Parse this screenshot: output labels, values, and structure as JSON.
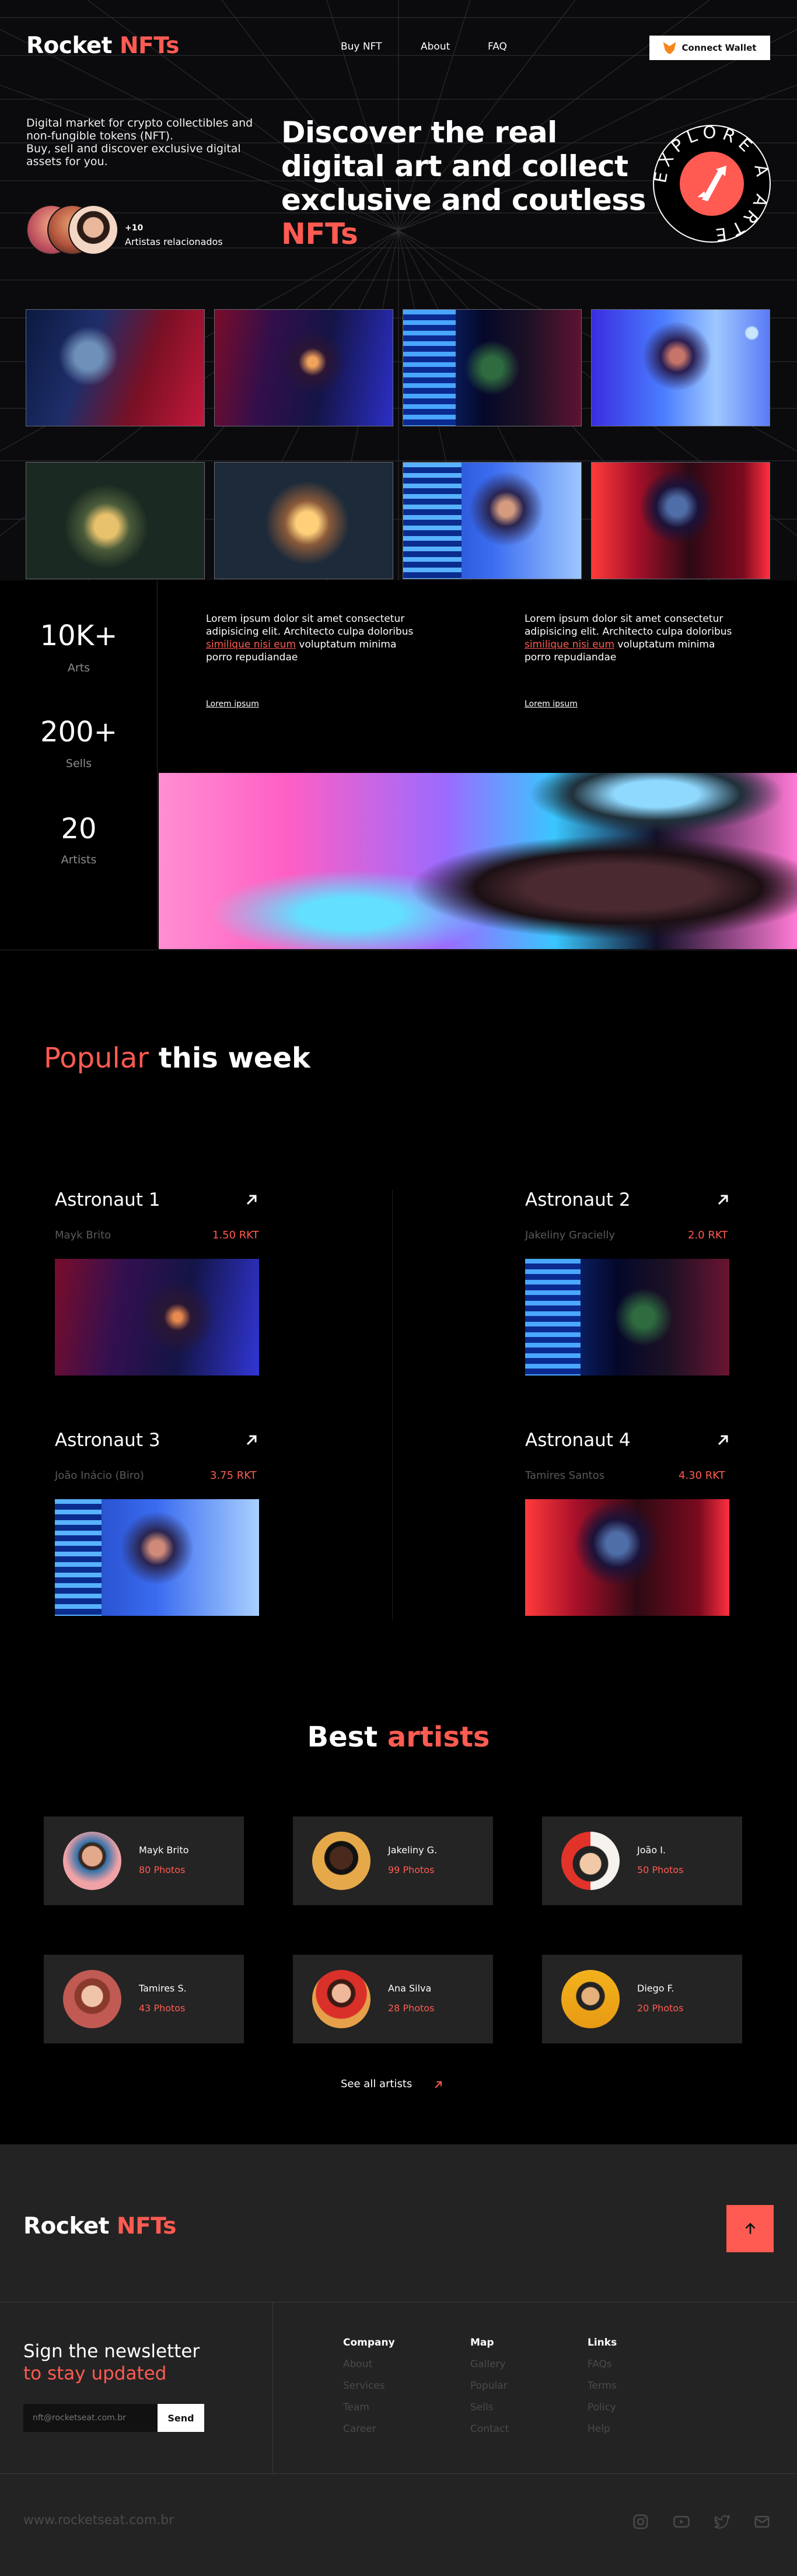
{
  "brand": {
    "part1": "Rocket",
    "part2": "NFTs"
  },
  "nav": {
    "items": [
      "Buy NFT",
      "About",
      "FAQ"
    ],
    "wallet_label": "Connect Wallet"
  },
  "hero": {
    "intro_line1": "Digital market for crypto collectibles and",
    "intro_line2": "non-fungible tokens (NFT).",
    "intro_line3": "Buy, sell and discover exclusive digital",
    "intro_line4": "assets for you.",
    "headline_line1": "Discover the real",
    "headline_line2": "digital art and collect",
    "headline_line3": "exclusive and coutless",
    "headline_accent": "NFTs",
    "artists_count": "+10",
    "artists_label": "Artistas relacionados",
    "badge_text": "EXPLORE A ARTE"
  },
  "stats": [
    {
      "value": "10K+",
      "label": "Arts"
    },
    {
      "value": "200+",
      "label": "Sells"
    },
    {
      "value": "20",
      "label": "Artists"
    }
  ],
  "lorem_blocks": [
    {
      "line1": "Lorem ipsum dolor sit amet consectetur",
      "line2": "adipisicing elit. Architecto culpa doloribus",
      "highlight": "similique nisi eum",
      "line3_rest": " voluptatum minima",
      "line4": "porro repudiandae",
      "link": "Lorem ipsum"
    },
    {
      "line1": "Lorem ipsum dolor sit amet consectetur",
      "line2": "adipisicing elit. Architecto culpa doloribus",
      "highlight": "similique nisi eum",
      "line3_rest": " voluptatum minima",
      "line4": "porro repudiandae",
      "link": "Lorem ipsum"
    }
  ],
  "popular": {
    "title_accent": "Popular",
    "title_rest": " this week",
    "cards": [
      {
        "title": "Astronaut 1",
        "author": "Mayk Brito",
        "price": "1.50 RKT"
      },
      {
        "title": "Astronaut 2",
        "author": "Jakeliny Gracielly",
        "price": "2.0 RKT"
      },
      {
        "title": "Astronaut 3",
        "author": "João Inácio (Biro)",
        "price": "3.75 RKT"
      },
      {
        "title": "Astronaut 4",
        "author": "Tamires Santos",
        "price": "4.30 RKT"
      }
    ]
  },
  "artists": {
    "title_rest": "Best ",
    "title_accent": "artists",
    "items": [
      {
        "name": "Mayk Brito",
        "photos": "80 Photos"
      },
      {
        "name": "Jakeliny G.",
        "photos": "99 Photos"
      },
      {
        "name": "João I.",
        "photos": "50 Photos"
      },
      {
        "name": "Tamires S.",
        "photos": "43 Photos"
      },
      {
        "name": "Ana Silva",
        "photos": "28 Photos"
      },
      {
        "name": "Diego F.",
        "photos": "20 Photos"
      }
    ],
    "see_all": "See all artists"
  },
  "newsletter": {
    "line1": "Sign the newsletter",
    "line2": "to stay updated",
    "placeholder": "nft@rocketseat.com.br",
    "button": "Send"
  },
  "footer_cols": [
    {
      "title": "Company",
      "links": [
        "About",
        "Services",
        "Team",
        "Career"
      ]
    },
    {
      "title": "Map",
      "links": [
        "Gallery",
        "Popular",
        "Sells",
        "Contact"
      ]
    },
    {
      "title": "Links",
      "links": [
        "FAQs",
        "Terms",
        "Policy",
        "Help"
      ]
    }
  ],
  "footer": {
    "url": "www.rocketseat.com.br"
  },
  "icons": [
    "metamask-fox-icon",
    "arrow-up-right-icon",
    "arrow-up-icon",
    "instagram-icon",
    "youtube-icon",
    "twitter-icon",
    "mail-icon"
  ],
  "colors": {
    "accent": "#ff5b52",
    "background": "#000000",
    "panel": "#242424",
    "footer": "#232323"
  }
}
